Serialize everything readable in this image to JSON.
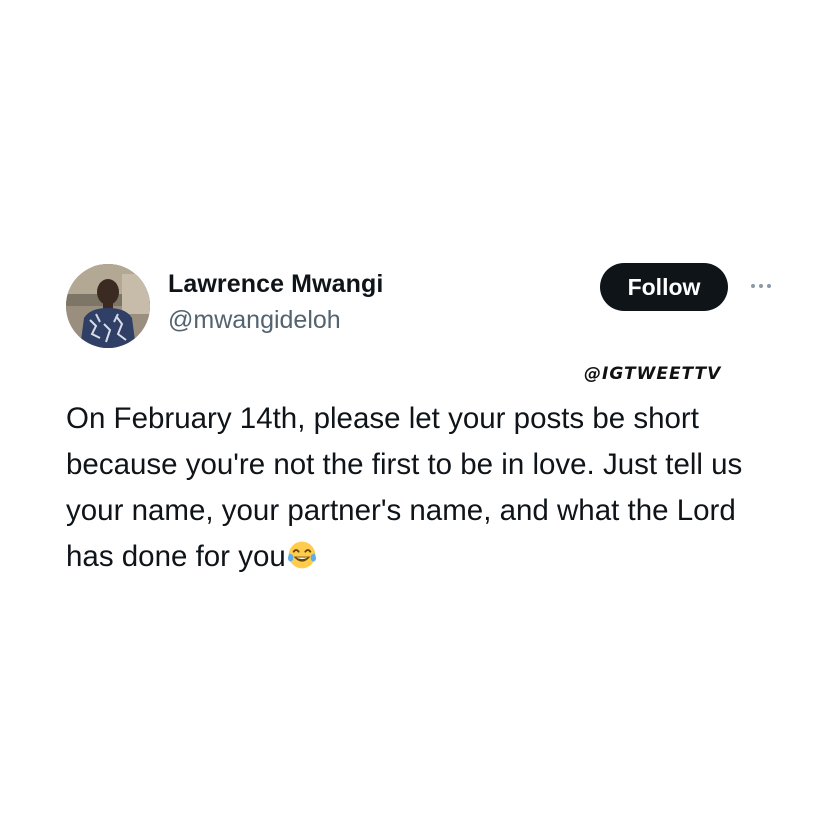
{
  "tweet": {
    "author": {
      "display_name": "Lawrence Mwangi",
      "handle": "@mwangideloh",
      "avatar_icon": "profile-photo"
    },
    "follow_label": "Follow",
    "more_icon": "ellipsis-icon",
    "watermark": "@IGTWEETTV",
    "text": "On February 14th, please let your posts be short because you're not the first to be in love. Just tell us your name, your partner's name, and what the Lord has done for you",
    "emoji": "face-with-tears-of-joy"
  },
  "colors": {
    "follow_bg": "#0f1419",
    "follow_text": "#ffffff",
    "handle": "#536471",
    "text": "#0f1419"
  }
}
